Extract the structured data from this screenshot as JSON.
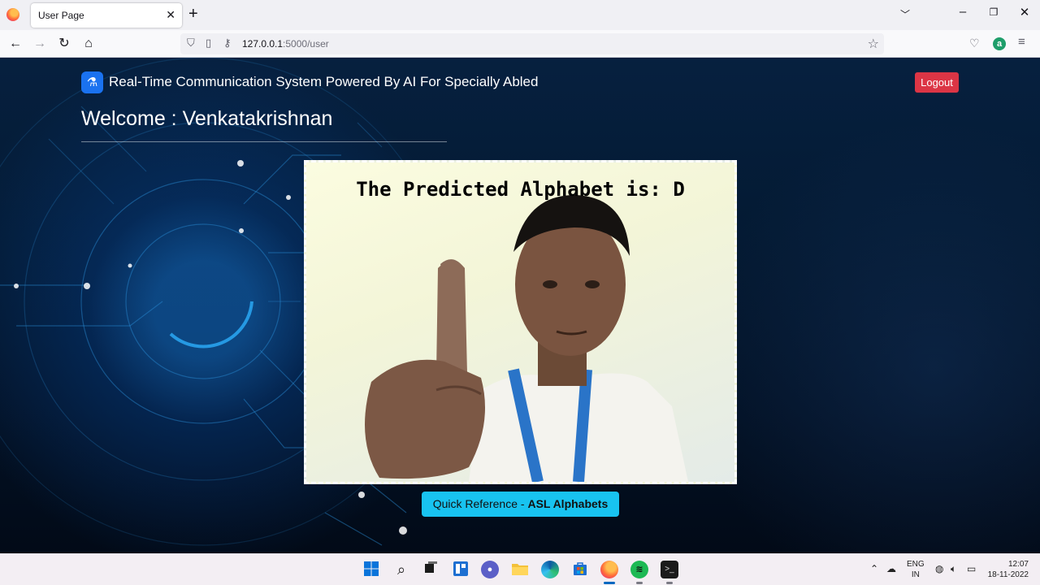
{
  "browser": {
    "tab_title": "User Page",
    "url_host": "127.0.0.1",
    "url_path": ":5000/user",
    "icons": [
      "firefox-icon",
      "close-icon",
      "plus-icon",
      "chevron-down-icon",
      "minimize-icon",
      "maximize-icon",
      "back-icon",
      "forward-icon",
      "reload-icon",
      "home-icon",
      "shield-icon",
      "page-icon",
      "key-icon",
      "star-icon",
      "pocket-icon",
      "account-icon",
      "menu-icon"
    ],
    "account_initial": "a"
  },
  "page": {
    "brand_title": "Real-Time Communication System Powered By AI For Specially Abled",
    "logout_label": "Logout",
    "welcome_text": "Welcome : Venkatakrishnan",
    "prediction_text": "The Predicted Alphabet is: D",
    "reference_prefix": "Quick Reference - ",
    "reference_bold": "ASL Alphabets",
    "colors": {
      "logout": "#dc3545",
      "reference_button": "#18c3f0",
      "brand_icon": "#1a72f0"
    }
  },
  "taskbar": {
    "apps": [
      "windows-start-icon",
      "search-icon",
      "task-view-icon",
      "widgets-icon",
      "chat-icon",
      "file-explorer-icon",
      "edge-icon",
      "store-icon",
      "firefox-icon",
      "spotify-icon",
      "terminal-icon"
    ],
    "lang_line1": "ENG",
    "lang_line2": "IN",
    "time": "12:07",
    "date": "18-11-2022"
  }
}
